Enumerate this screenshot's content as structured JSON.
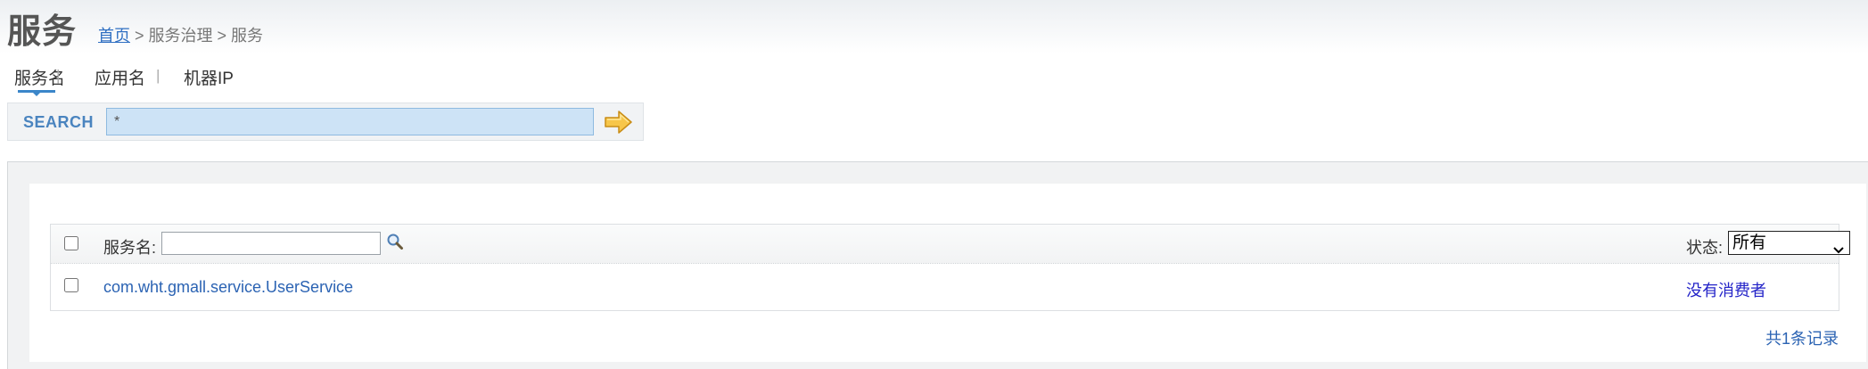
{
  "page": {
    "title": "服务"
  },
  "breadcrumb": {
    "home": "首页",
    "rest": " > 服务治理 > 服务"
  },
  "tabs": [
    {
      "label": "服务名",
      "active": true
    },
    {
      "label": "应用名",
      "active": false
    },
    {
      "label": "机器IP",
      "active": false
    }
  ],
  "tab_separator": "|",
  "search": {
    "label": "SEARCH",
    "value": "*",
    "go_icon": "arrow-right-icon"
  },
  "table": {
    "filter_label": "服务名:",
    "filter_value": "",
    "filter_icon": "magnifier-icon",
    "status_label": "状态:",
    "status_selected": "所有",
    "rows": [
      {
        "service": "com.wht.gmall.service.UserService",
        "status": "没有消费者"
      }
    ],
    "record_count": "共1条记录"
  },
  "colors": {
    "link": "#2b63b3",
    "status_link": "#2323c8",
    "search_label": "#4a84bf",
    "search_field": "#cde3f6",
    "tab_indicator": "#3b86c9"
  }
}
